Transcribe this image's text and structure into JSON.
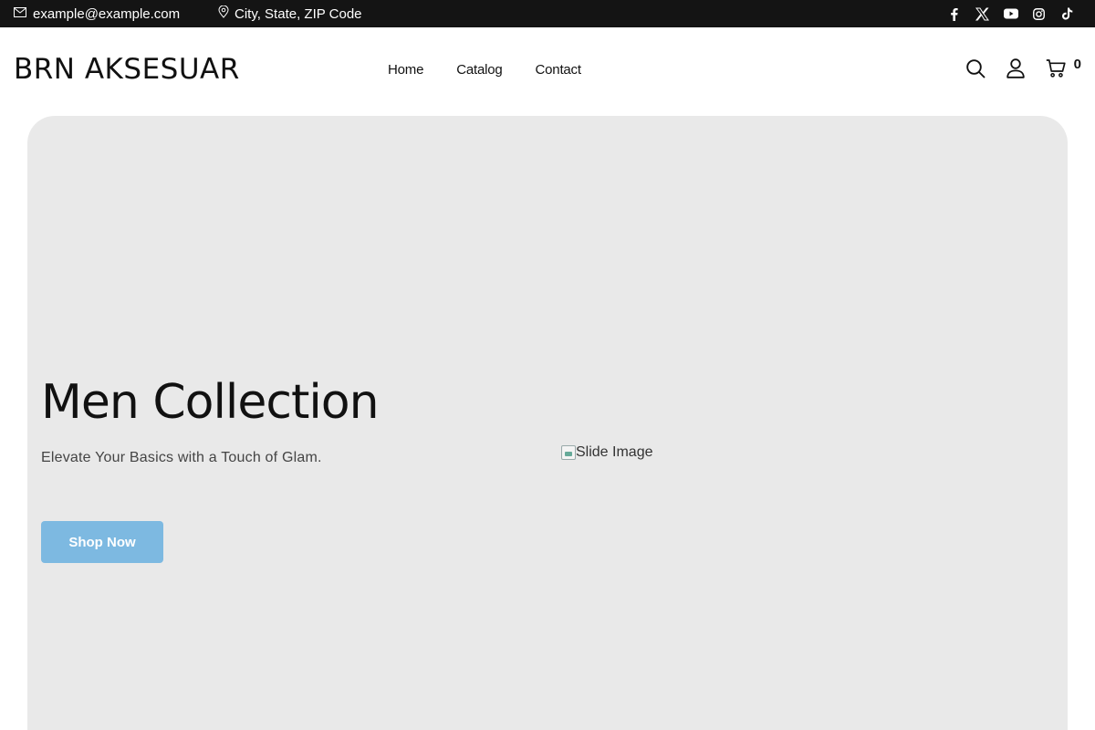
{
  "topbar": {
    "email": "example@example.com",
    "location": "City, State, ZIP Code",
    "social_icons": [
      "facebook-icon",
      "x-icon",
      "youtube-icon",
      "instagram-icon",
      "tiktok-icon"
    ]
  },
  "header": {
    "logo": "BRN AKSESUAR",
    "nav": [
      {
        "label": "Home"
      },
      {
        "label": "Catalog"
      },
      {
        "label": "Contact"
      }
    ],
    "icons": [
      "search-icon",
      "user-icon",
      "cart-icon"
    ],
    "cart_count": "0"
  },
  "hero": {
    "title": "Men Collection",
    "subtitle": "Elevate Your Basics with a Touch of Glam.",
    "button_label": "Shop Now",
    "image_alt": "Slide Image"
  },
  "colors": {
    "topbar_bg": "#141414",
    "hero_bg": "#e9e9e9",
    "button_bg": "#7db9e1"
  }
}
